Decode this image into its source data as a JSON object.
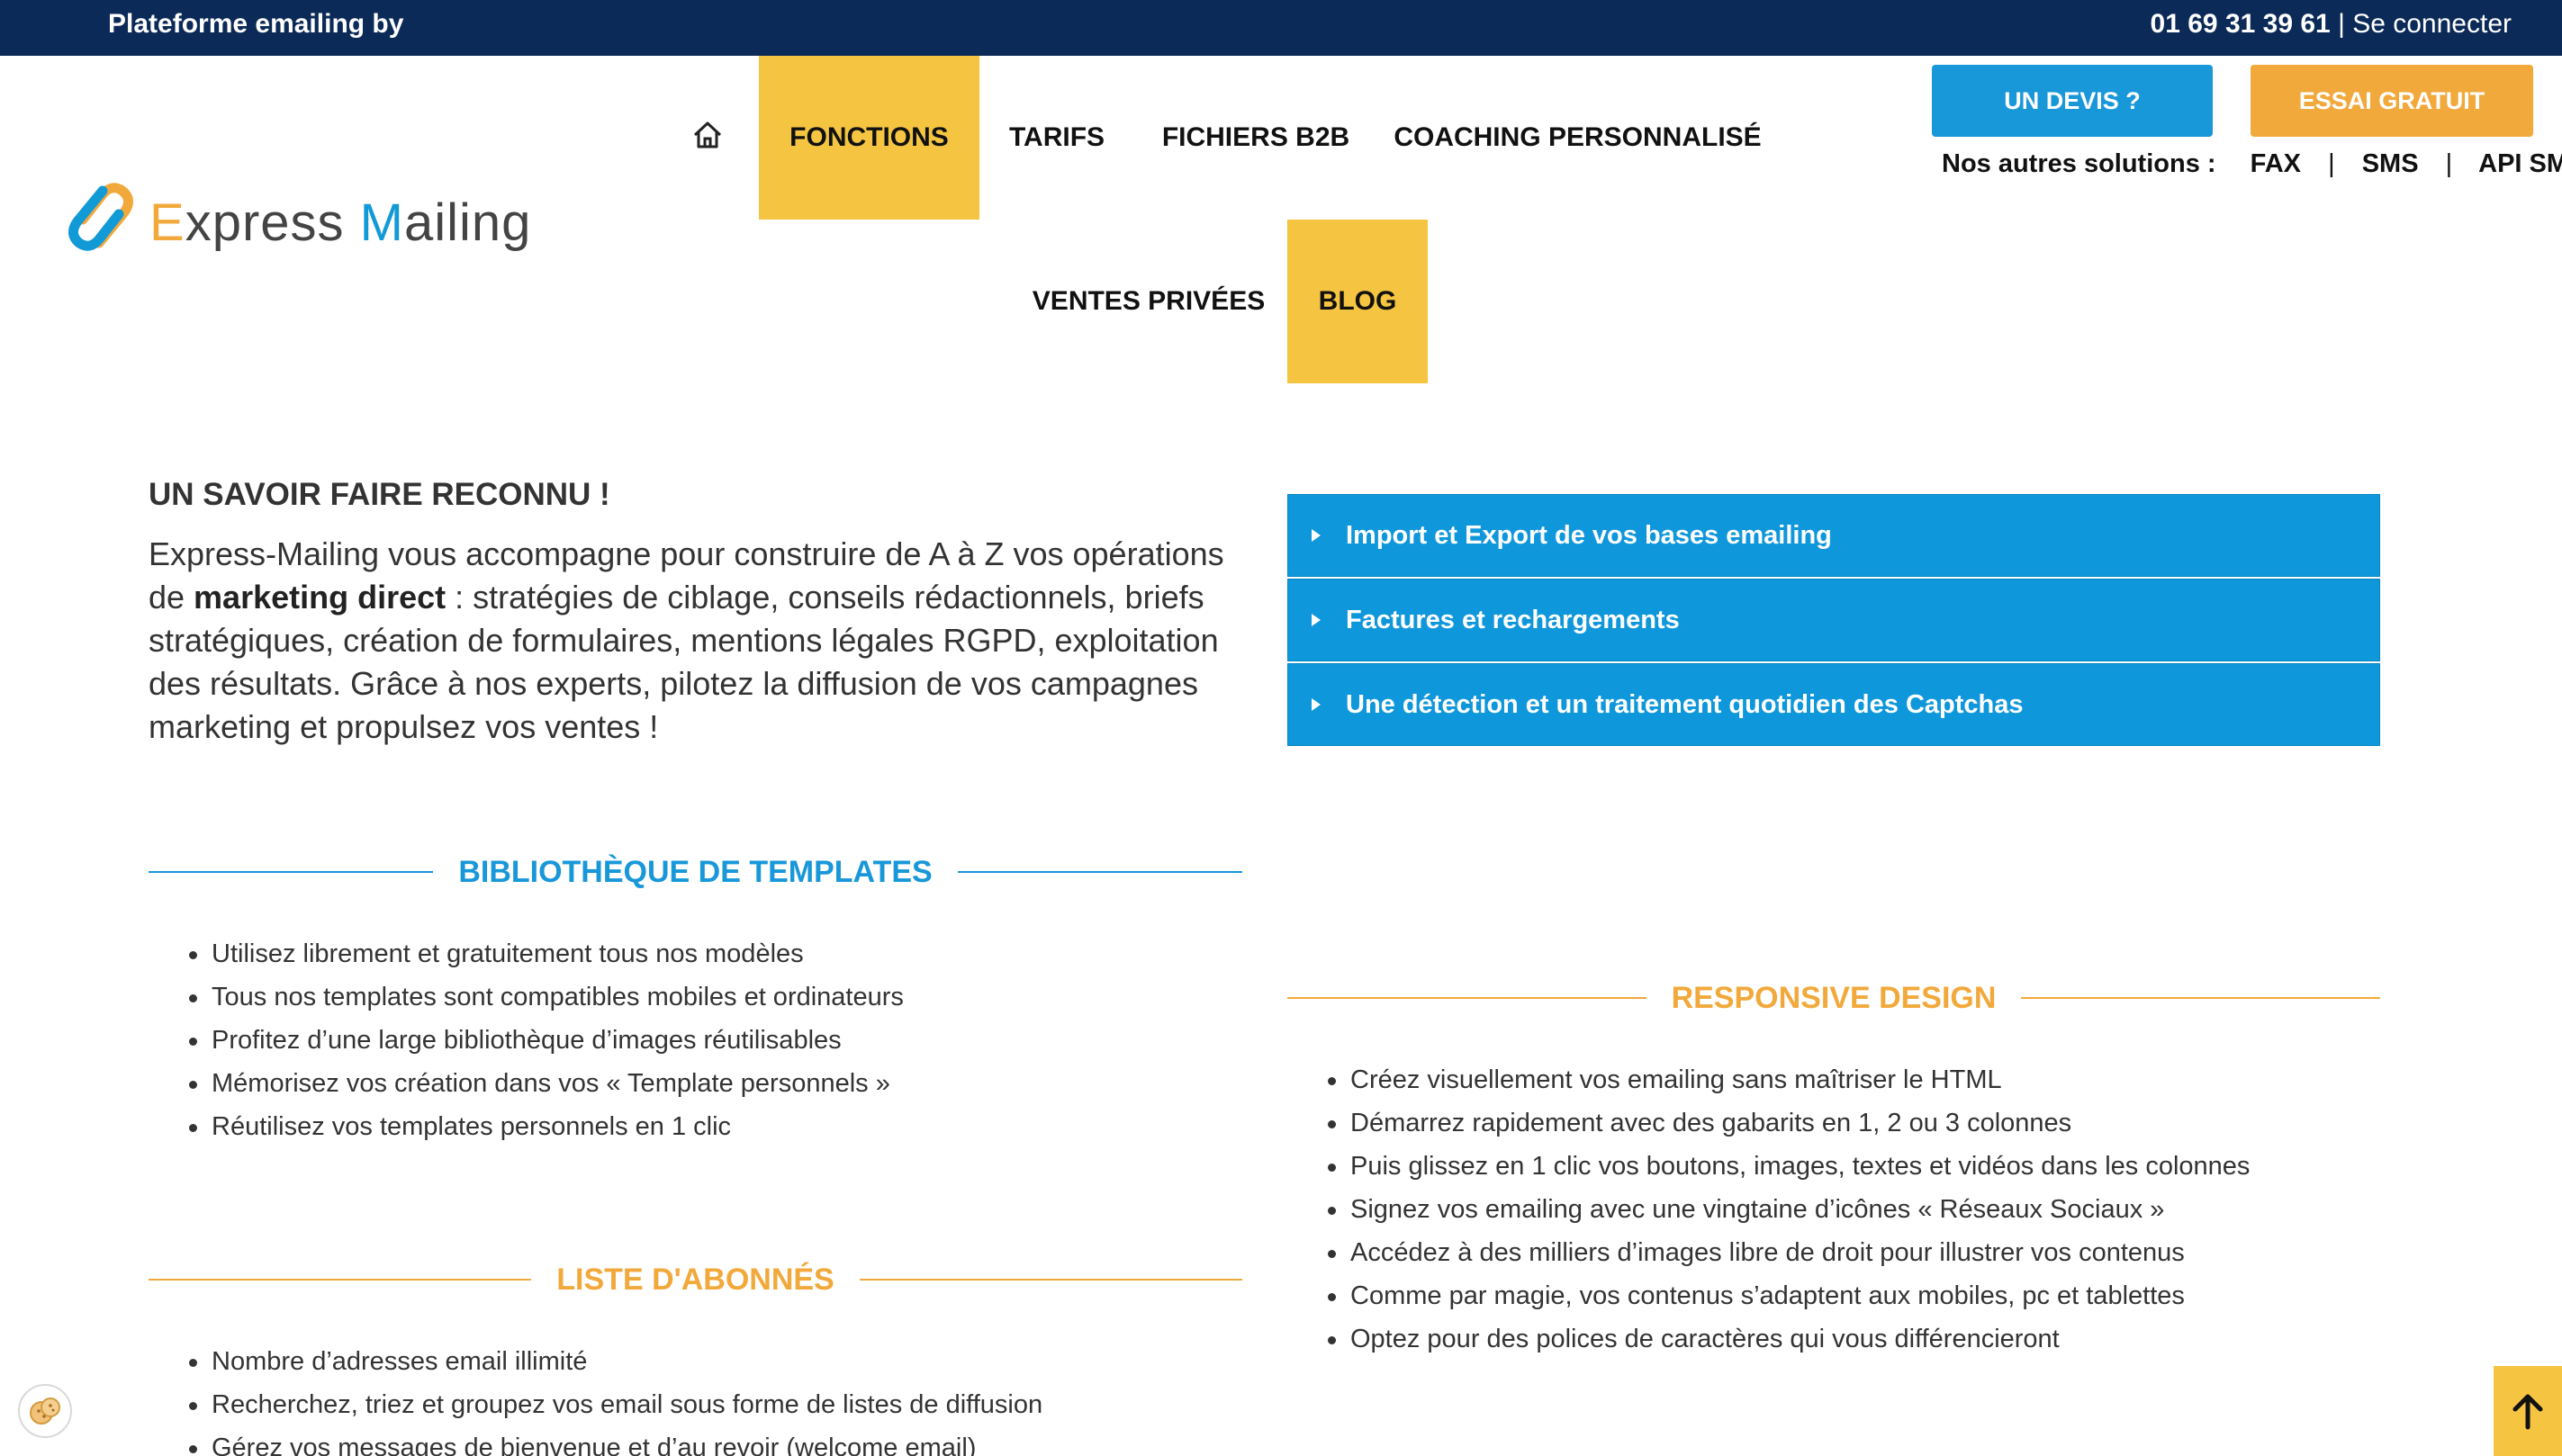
{
  "topbar": {
    "brand": "Plateforme emailing by",
    "phone": "01 69 31 39 61",
    "separator": "|",
    "login": "Se connecter"
  },
  "logo": {
    "first_letter": "E",
    "part1": "xpress ",
    "second_letter": "M",
    "part2": "ailing"
  },
  "nav": {
    "items": [
      {
        "label": "FONCTIONS",
        "active": true
      },
      {
        "label": "TARIFS",
        "active": false
      },
      {
        "label": "FICHIERS B2B",
        "active": false
      },
      {
        "label": "COACHING PERSONNALISÉ",
        "active": false
      },
      {
        "label": "VENTES PRIVÉES",
        "active": false
      },
      {
        "label": "BLOG",
        "active": true
      }
    ]
  },
  "cta": {
    "devis": "UN DEVIS ?",
    "essai": "ESSAI GRATUIT"
  },
  "solutions": {
    "label": "Nos autres solutions :",
    "items": [
      "FAX",
      "SMS",
      "API SMTP"
    ],
    "sep": "|"
  },
  "main": {
    "heading": "UN SAVOIR FAIRE RECONNU !",
    "intro_before": "Express-Mailing vous accompagne pour construire de A à Z vos opérations de ",
    "intro_bold": "marketing direct",
    "intro_after": " : stratégies de ciblage, conseils rédactionnels, briefs stratégiques, création de formulaires, mentions légales RGPD, exploitation des résultats. Grâce à nos experts, pilotez la diffusion de vos campagnes marketing et propulsez vos ventes !"
  },
  "accordion": {
    "items": [
      "Import et Export de vos bases emailing",
      "Factures et rechargements",
      "Une détection et un traitement quotidien des Captchas"
    ]
  },
  "templates": {
    "title": "BIBLIOTHÈQUE DE TEMPLATES",
    "items": [
      "Utilisez librement et gratuitement tous nos modèles",
      "Tous nos templates sont compatibles mobiles et ordinateurs",
      "Profitez d’une large bibliothèque d’images réutilisables",
      "Mémorisez vos création dans vos « Template personnels »",
      "Réutilisez vos templates personnels en 1 clic"
    ]
  },
  "responsive": {
    "title": "RESPONSIVE DESIGN",
    "items": [
      "Créez visuellement vos emailing sans maîtriser le HTML",
      "Démarrez rapidement avec des gabarits en 1, 2 ou 3 colonnes",
      "Puis glissez en 1 clic vos boutons, images, textes et vidéos dans les colonnes",
      "Signez vos emailing avec une vingtaine d’icônes « Réseaux Sociaux »",
      "Accédez à des milliers d’images libre de droit pour illustrer vos contenus",
      "Comme par magie, vos contenus s’adaptent aux mobiles, pc et tablettes",
      "Optez pour des polices de caractères qui vous différencieront"
    ]
  },
  "abonnes": {
    "title": "LISTE D'ABONNÉS",
    "items": [
      "Nombre d’adresses email illimité",
      "Recherchez, triez et groupez vos email sous forme de listes de diffusion",
      "Gérez vos messages de bienvenue et d’au revoir (welcome email)"
    ]
  },
  "colors": {
    "navy": "#0b2a57",
    "blue": "#1897d9",
    "orange": "#f2a93b",
    "yellow": "#f5c542"
  },
  "icons": {
    "home": "home-icon",
    "cookie": "cookie-icon",
    "scroll_top": "arrow-up-icon",
    "accordion": "triangle-right-icon"
  }
}
